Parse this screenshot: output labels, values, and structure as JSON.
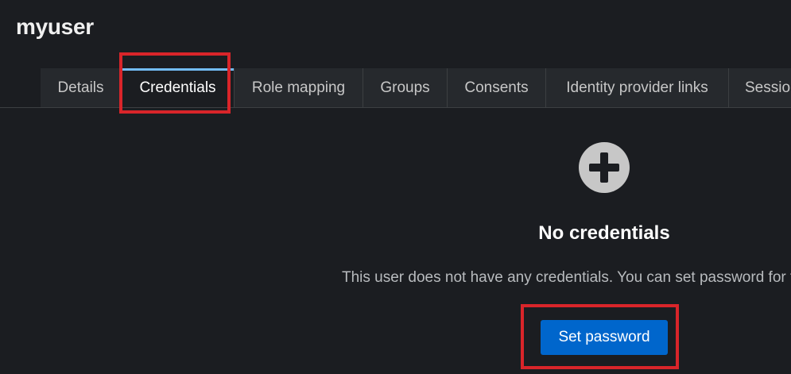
{
  "header": {
    "title": "myuser"
  },
  "tabs": [
    {
      "label": "Details",
      "active": false
    },
    {
      "label": "Credentials",
      "active": true
    },
    {
      "label": "Role mapping",
      "active": false
    },
    {
      "label": "Groups",
      "active": false
    },
    {
      "label": "Consents",
      "active": false
    },
    {
      "label": "Identity provider links",
      "active": false
    },
    {
      "label": "Sessions",
      "active": false
    }
  ],
  "empty_state": {
    "icon": "plus-circle-icon",
    "title": "No credentials",
    "body": "This user does not have any credentials. You can set password for this user.",
    "button_label": "Set password"
  },
  "colors": {
    "background": "#1b1d21",
    "tab_background": "#26292d",
    "active_tab_indicator": "#73bcf7",
    "primary_button": "#0066cc",
    "highlight": "#d9252a",
    "icon": "#c7c7c7"
  }
}
